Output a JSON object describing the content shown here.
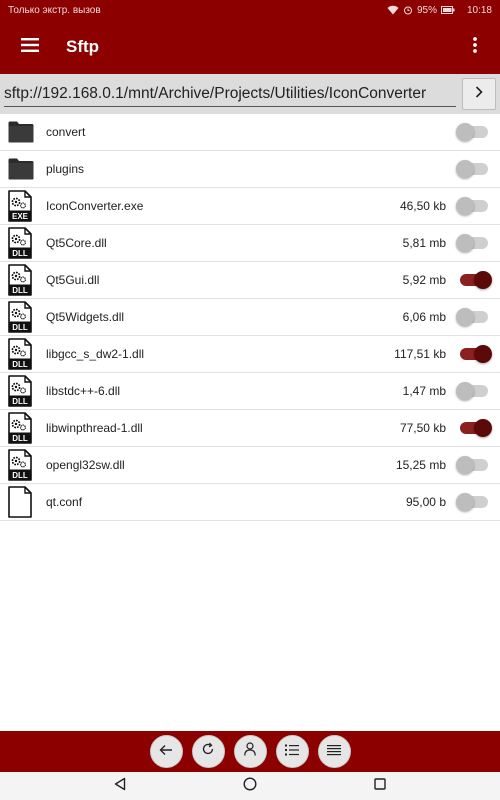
{
  "status": {
    "carrier": "Только экстр. вызов",
    "battery": "95%",
    "time": "10:18"
  },
  "app": {
    "title": "Sftp"
  },
  "path": {
    "value": "sftp://192.168.0.1/mnt/Archive/Projects/Utilities/IconConverter"
  },
  "files": [
    {
      "name": "convert",
      "size": "",
      "icon": "folder-icon",
      "selected": false
    },
    {
      "name": "plugins",
      "size": "",
      "icon": "folder-icon",
      "selected": false
    },
    {
      "name": "IconConverter.exe",
      "size": "46,50 kb",
      "icon": "exe-file-icon",
      "badge": "EXE",
      "selected": false
    },
    {
      "name": "Qt5Core.dll",
      "size": "5,81 mb",
      "icon": "dll-file-icon",
      "badge": "DLL",
      "selected": false
    },
    {
      "name": "Qt5Gui.dll",
      "size": "5,92 mb",
      "icon": "dll-file-icon",
      "badge": "DLL",
      "selected": true
    },
    {
      "name": "Qt5Widgets.dll",
      "size": "6,06 mb",
      "icon": "dll-file-icon",
      "badge": "DLL",
      "selected": false
    },
    {
      "name": "libgcc_s_dw2-1.dll",
      "size": "117,51 kb",
      "icon": "dll-file-icon",
      "badge": "DLL",
      "selected": true
    },
    {
      "name": "libstdc++-6.dll",
      "size": "1,47 mb",
      "icon": "dll-file-icon",
      "badge": "DLL",
      "selected": false
    },
    {
      "name": "libwinpthread-1.dll",
      "size": "77,50 kb",
      "icon": "dll-file-icon",
      "badge": "DLL",
      "selected": true
    },
    {
      "name": "opengl32sw.dll",
      "size": "15,25 mb",
      "icon": "dll-file-icon",
      "badge": "DLL",
      "selected": false
    },
    {
      "name": "qt.conf",
      "size": "95,00 b",
      "icon": "file-icon",
      "selected": false
    }
  ],
  "toolbar": {
    "buttons": [
      {
        "icon": "back-arrow-icon"
      },
      {
        "icon": "refresh-icon"
      },
      {
        "icon": "user-icon"
      },
      {
        "icon": "numbered-list-icon"
      },
      {
        "icon": "list-icon"
      }
    ]
  },
  "colors": {
    "primary": "#8c0000",
    "toggle_on": "#5c0909",
    "path_bg": "#dcdcdc"
  }
}
